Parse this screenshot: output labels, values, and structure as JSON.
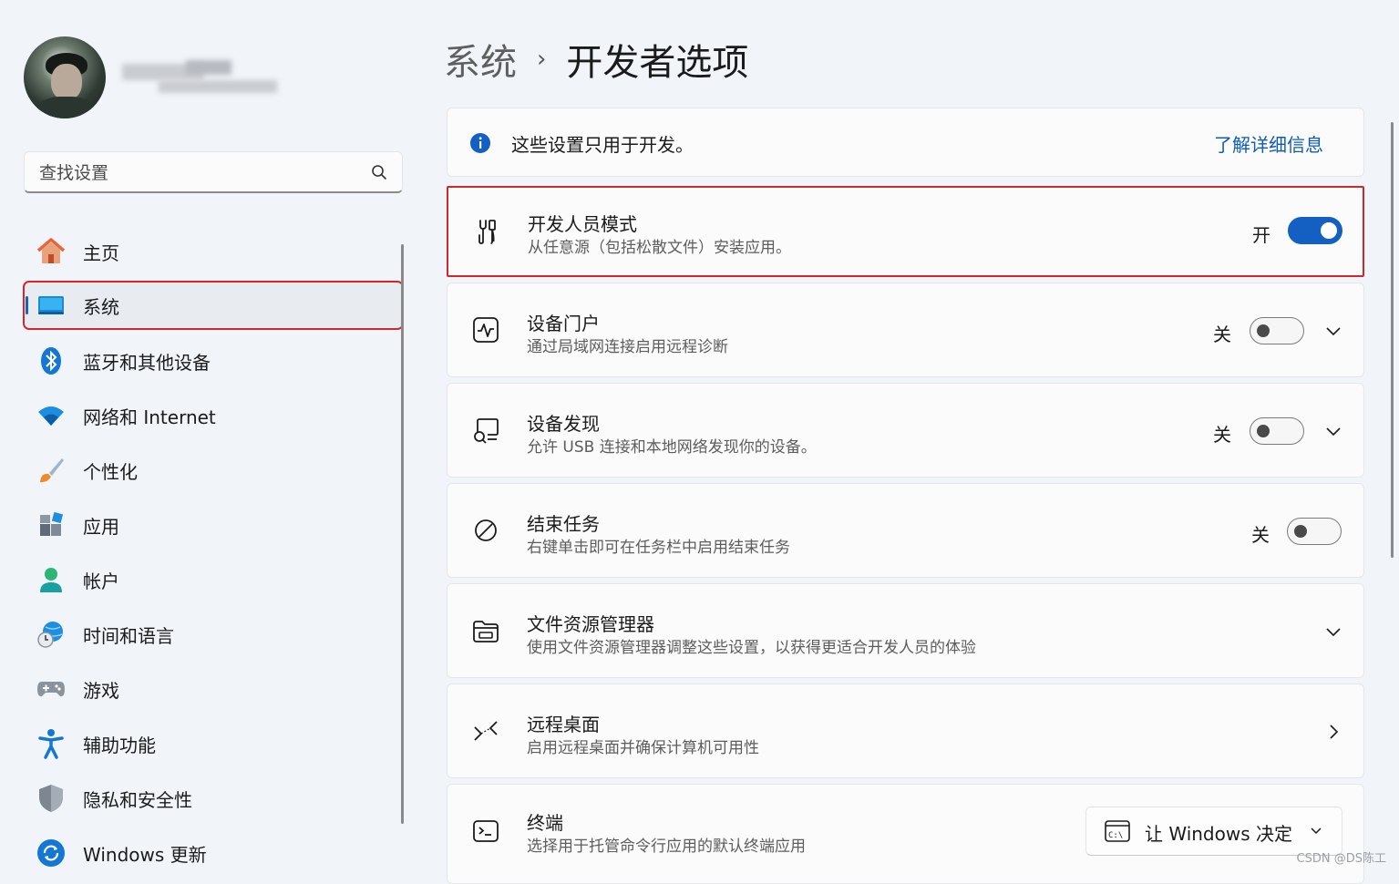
{
  "sidebar": {
    "search_placeholder": "查找设置",
    "items": [
      {
        "label": "主页",
        "icon": "home-icon"
      },
      {
        "label": "系统",
        "icon": "system-icon",
        "active": true
      },
      {
        "label": "蓝牙和其他设备",
        "icon": "bluetooth-icon"
      },
      {
        "label": "网络和 Internet",
        "icon": "wifi-icon"
      },
      {
        "label": "个性化",
        "icon": "brush-icon"
      },
      {
        "label": "应用",
        "icon": "apps-icon"
      },
      {
        "label": "帐户",
        "icon": "account-icon"
      },
      {
        "label": "时间和语言",
        "icon": "globe-clock-icon"
      },
      {
        "label": "游戏",
        "icon": "gamepad-icon"
      },
      {
        "label": "辅助功能",
        "icon": "accessibility-icon"
      },
      {
        "label": "隐私和安全性",
        "icon": "shield-icon"
      },
      {
        "label": "Windows 更新",
        "icon": "update-icon"
      }
    ]
  },
  "breadcrumb": {
    "parent": "系统",
    "separator": "›",
    "current": "开发者选项"
  },
  "info": {
    "text": "这些设置只用于开发。",
    "link": "了解详细信息"
  },
  "settings": [
    {
      "title": "开发人员模式",
      "desc": "从任意源（包括松散文件）安装应用。",
      "state": "开",
      "on": true,
      "icon": "tools-icon"
    },
    {
      "title": "设备门户",
      "desc": "通过局域网连接启用远程诊断",
      "state": "关",
      "on": false,
      "icon": "pulse-icon"
    },
    {
      "title": "设备发现",
      "desc": "允许 USB 连接和本地网络发现你的设备。",
      "state": "关",
      "on": false,
      "icon": "device-search-icon"
    },
    {
      "title": "结束任务",
      "desc": "右键单击即可在任务栏中启用结束任务",
      "state": "关",
      "on": false,
      "icon": "block-icon"
    },
    {
      "title": "文件资源管理器",
      "desc": "使用文件资源管理器调整这些设置，以获得更适合开发人员的体验",
      "icon": "folder-icon"
    },
    {
      "title": "远程桌面",
      "desc": "启用远程桌面并确保计算机可用性",
      "icon": "remote-icon"
    },
    {
      "title": "终端",
      "desc": "选择用于托管命令行应用的默认终端应用",
      "dropdown_value": "让 Windows 决定",
      "icon": "terminal-icon"
    }
  ],
  "watermark": "CSDN @DS陈工",
  "colors": {
    "accent": "#1460c2",
    "highlight": "#d1282e",
    "link": "#0f5cb4"
  }
}
